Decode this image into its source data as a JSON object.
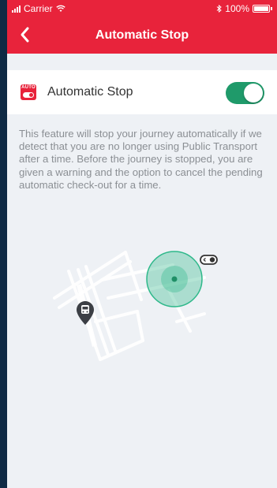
{
  "status_bar": {
    "carrier": "Carrier",
    "time": "",
    "bluetooth_icon": "bluetooth-icon",
    "battery_percent": "100%"
  },
  "nav": {
    "title": "Automatic Stop",
    "back_icon": "chevron-left-icon"
  },
  "setting": {
    "icon_text": "AUTO",
    "label": "Automatic Stop",
    "enabled": true
  },
  "description": "This feature will stop your journey automatically if we detect that you are no longer using Public Transport after a time. Before the journey is stopped, you are given a warning and the option to cancel the pending automatic check-out for a time.",
  "colors": {
    "brand_red": "#e8233b",
    "toggle_green": "#1f9a6a",
    "zone_green": "#2eb88a",
    "background": "#eef1f5"
  }
}
